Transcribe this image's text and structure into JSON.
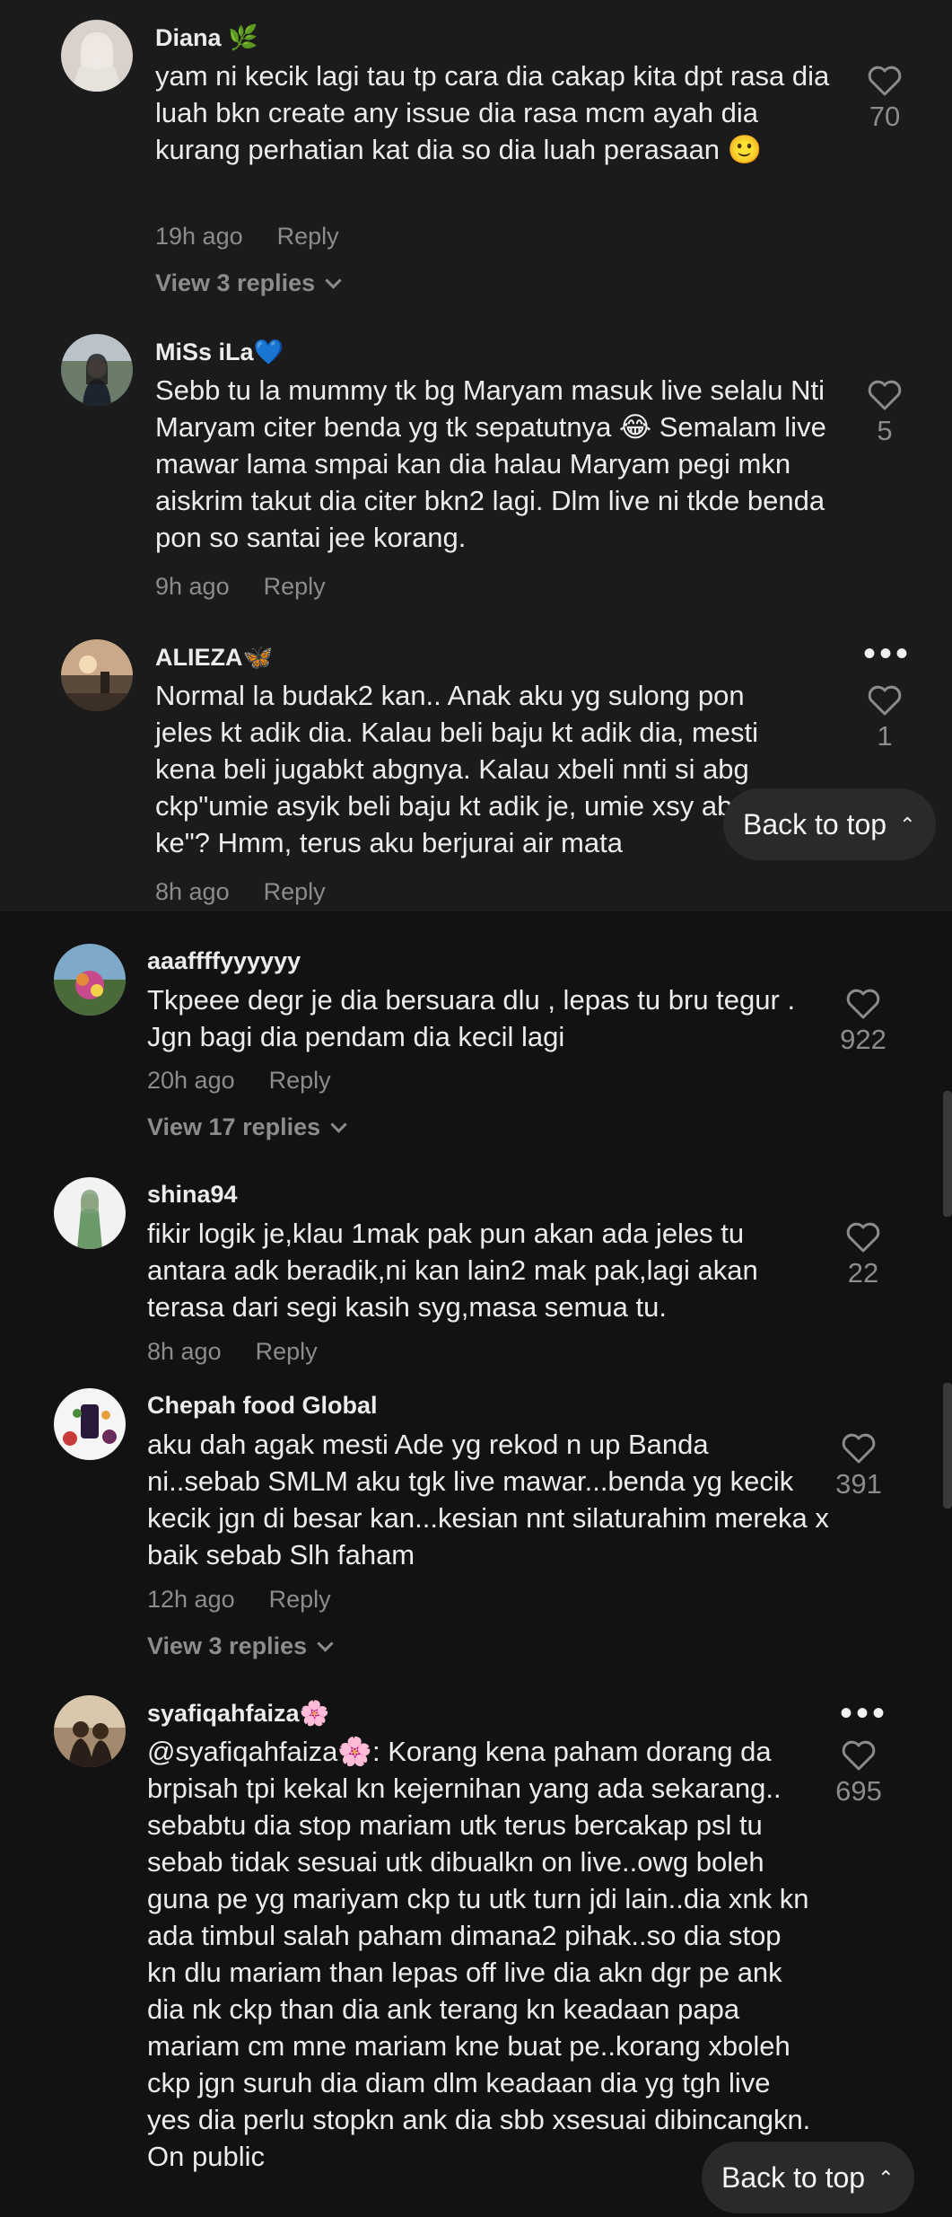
{
  "comments": [
    {
      "username": "Diana 🌿",
      "text": "yam ni kecik lagi tau tp cara dia cakap kita dpt rasa dia luah bkn create any issue dia rasa mcm ayah dia kurang perhatian kat dia so dia luah perasaan 🙂",
      "time": "19h ago",
      "reply": "Reply",
      "likes": "70",
      "view_replies": "View 3 replies"
    },
    {
      "username": "MiSs iLa💙",
      "text": "Sebb tu la mummy tk bg Maryam masuk live selalu Nti Maryam citer benda yg tk sepatutnya 😂 Semalam live mawar lama smpai kan dia halau Maryam pegi mkn aiskrim takut dia citer bkn2 lagi. Dlm live ni tkde benda pon so santai jee korang.",
      "time": "9h ago",
      "reply": "Reply",
      "likes": "5"
    },
    {
      "username": "ALIEZA🦋",
      "text": "Normal la budak2 kan.. Anak aku yg sulong pon jeles kt adik dia. Kalau beli baju kt adik dia, mesti kena beli jugabkt abgnya. Kalau xbeli nnti si abg ckp\"umie asyik beli baju kt adik je, umie xsy abg ke\"? Hmm, terus aku berjurai air mata",
      "time": "8h ago",
      "reply": "Reply",
      "likes": "1"
    },
    {
      "username": "aaaffffyyyyyy",
      "text": "Tkpeee degr je dia bersuara dlu , lepas tu bru tegur . Jgn bagi dia pendam dia kecil lagi",
      "time": "20h ago",
      "reply": "Reply",
      "likes": "922",
      "view_replies": "View 17 replies"
    },
    {
      "username": "shina94",
      "text": "fikir logik je,klau 1mak pak pun akan ada jeles tu antara adk beradik,ni kan lain2 mak pak,lagi akan terasa dari segi kasih syg,masa semua tu.",
      "time": "8h ago",
      "reply": "Reply",
      "likes": "22"
    },
    {
      "username": "Chepah food Global",
      "text": "aku dah agak mesti Ade yg rekod n up Banda ni..sebab SMLM aku tgk live mawar...benda yg kecik kecik jgn di besar kan...kesian nnt silaturahim mereka x baik sebab Slh faham",
      "time": "12h ago",
      "reply": "Reply",
      "likes": "391",
      "view_replies": "View 3 replies"
    },
    {
      "username": "syafiqahfaiza🌸",
      "text": "@syafiqahfaiza🌸: Korang kena paham dorang da brpisah tpi kekal kn kejernihan yang ada sekarang.. sebabtu dia stop mariam utk terus bercakap psl tu sebab tidak sesuai utk dibualkn on live..owg boleh guna pe yg mariyam ckp tu utk turn jdi lain..dia xnk kn ada timbul salah paham dimana2 pihak..so dia stop kn dlu mariam than lepas off live dia akn dgr pe ank dia nk ckp than dia ank terang kn keadaan papa mariam cm mne mariam kne buat pe..korang xboleh ckp jgn suruh dia diam dlm keadaan dia yg tgh live yes dia perlu stopkn ank dia sbb xsesuai dibincangkn. On public",
      "likes": "695"
    }
  ],
  "back_to_top": "Back to top",
  "back_to_top_partial": "Back to top"
}
